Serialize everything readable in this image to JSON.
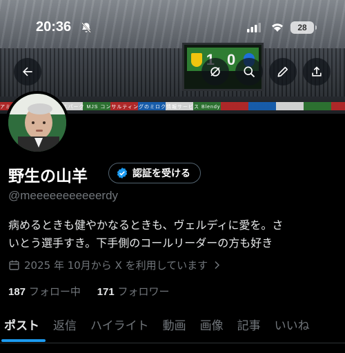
{
  "status_bar": {
    "time": "20:36",
    "battery": "28",
    "icons": [
      "bell-slash-icon",
      "signal-icon",
      "wifi-icon"
    ]
  },
  "header": {
    "buttons": [
      "back-arrow-icon",
      "mute-icon",
      "search-icon",
      "edit-icon",
      "share-icon"
    ]
  },
  "banner": {
    "scoreboard_score": "1 0",
    "ad_text": "アミノバイタル   カッコエスパーク   MJS コンサルティングのミロク情報サービス   Blendy"
  },
  "profile": {
    "display_name": "野生の山羊",
    "verify_label": "認証を受ける",
    "handle": "@meeeeeeeeeeerdy",
    "bio_line1": "病めるときも健やかなるときも、ヴェルディに愛を。さ",
    "bio_line2": "いとう選手すき。下手側のコールリーダーの方も好き",
    "joined": "2025 年 10月から X を利用しています",
    "following_count": "187",
    "following_label": "フォロー中",
    "followers_count": "171",
    "followers_label": "フォロワー"
  },
  "tabs": [
    {
      "label": "ポスト",
      "active": true
    },
    {
      "label": "返信"
    },
    {
      "label": "ハイライト"
    },
    {
      "label": "動画"
    },
    {
      "label": "画像"
    },
    {
      "label": "記事"
    },
    {
      "label": "いいね"
    }
  ],
  "colors": {
    "accent": "#1d9bf0",
    "background": "#000000",
    "muted_text": "#71767b"
  }
}
